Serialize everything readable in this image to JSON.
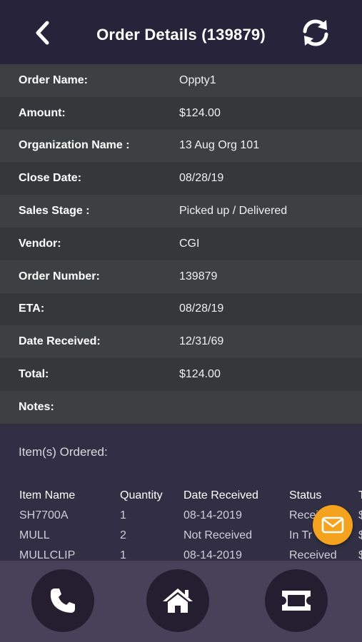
{
  "header": {
    "title": "Order Details (139879)",
    "back_icon": "chevron-left-icon",
    "refresh_icon": "refresh-icon"
  },
  "details": [
    {
      "label": "Order Name:",
      "value": "Oppty1"
    },
    {
      "label": "Amount:",
      "value": "$124.00"
    },
    {
      "label": "Organization Name :",
      "value": "13 Aug Org 101"
    },
    {
      "label": "Close Date:",
      "value": "08/28/19"
    },
    {
      "label": "Sales Stage :",
      "value": "Picked up / Delivered"
    },
    {
      "label": "Vendor:",
      "value": "CGI"
    },
    {
      "label": "Order Number:",
      "value": "139879"
    },
    {
      "label": "ETA:",
      "value": "08/28/19"
    },
    {
      "label": "Date Received:",
      "value": "12/31/69"
    },
    {
      "label": "Total:",
      "value": "$124.00"
    },
    {
      "label": "Notes:",
      "value": ""
    }
  ],
  "items": {
    "title": "Item(s) Ordered:",
    "columns": [
      "Item Name",
      "Quantity",
      "Date Received",
      "Status",
      "T"
    ],
    "rows": [
      [
        "SH7700A",
        "1",
        "08-14-2019",
        "Recei",
        "$"
      ],
      [
        "MULL",
        "2",
        "Not Received",
        "In Tr",
        "$"
      ],
      [
        "MULLCLIP",
        "1",
        "08-14-2019",
        "Received",
        "$"
      ]
    ]
  },
  "fab": {
    "icon": "mail-icon"
  },
  "bottom_nav": [
    {
      "icon": "phone-icon"
    },
    {
      "icon": "home-icon"
    },
    {
      "icon": "ticket-icon"
    }
  ],
  "colors": {
    "header_bg": "#26233a",
    "row_light": "#3c4043",
    "row_dark": "#34383b",
    "items_bg": "#322e43",
    "fab": "#f5a31e",
    "bottom_bar": "#47425a",
    "nav_button": "#231f30"
  }
}
